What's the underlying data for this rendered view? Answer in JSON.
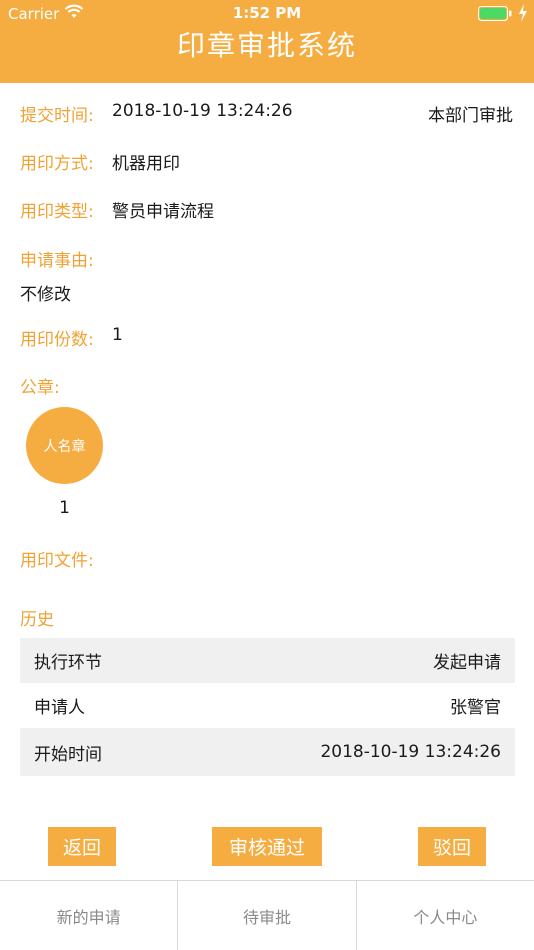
{
  "status_bar": {
    "carrier": "Carrier",
    "time": "1:52 PM"
  },
  "header": {
    "title": "印章审批系统"
  },
  "form": {
    "submit_time_label": "提交时间:",
    "submit_time_value": "2018-10-19 13:24:26",
    "approval_scope": "本部门审批",
    "method_label": "用印方式:",
    "method_value": "机器用印",
    "type_label": "用印类型:",
    "type_value": "警员申请流程",
    "reason_label": "申请事由:",
    "reason_value": "不修改",
    "copies_label": "用印份数:",
    "copies_value": "1",
    "seal_label": "公章:",
    "seal_name": "人名章",
    "seal_count": "1",
    "files_label": "用印文件:"
  },
  "history": {
    "title": "历史",
    "rows": [
      {
        "key": "执行环节",
        "value": "发起申请"
      },
      {
        "key": "申请人",
        "value": "张警官"
      },
      {
        "key": "开始时间",
        "value": "2018-10-19 13:24:26"
      }
    ]
  },
  "actions": {
    "back": "返回",
    "approve": "审核通过",
    "reject": "驳回"
  },
  "tabs": [
    {
      "label": "新的申请"
    },
    {
      "label": "待审批"
    },
    {
      "label": "个人中心"
    }
  ],
  "colors": {
    "accent": "#f5ad42",
    "label": "#f0a234",
    "battery": "#4cd964"
  }
}
